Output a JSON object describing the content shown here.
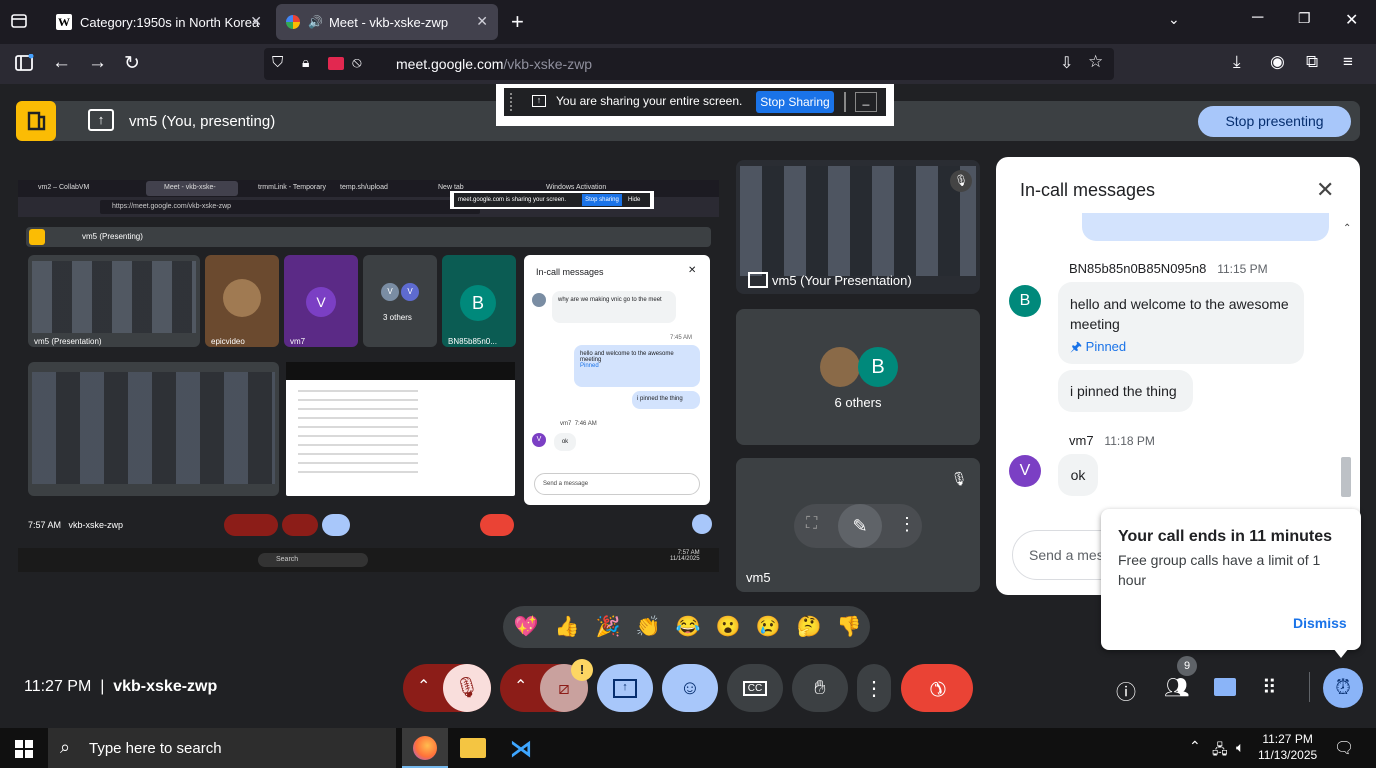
{
  "browser": {
    "tabs": [
      {
        "title": "Category:1950s in North Korea",
        "favicon": "W",
        "active": false
      },
      {
        "title": "Meet - vkb-xske-zwp",
        "active": true
      }
    ],
    "new_tab": "+",
    "url": {
      "domain": "meet.google.com",
      "path": "/vkb-xske-zwp"
    }
  },
  "share_notice": {
    "text": "You are sharing your entire screen.",
    "stop_button": "Stop Sharing",
    "hide_button": "_"
  },
  "presenting_bar": {
    "label": "vm5 (You, presenting)",
    "stop_button": "Stop presenting"
  },
  "tiles": {
    "presentation_label": "vm5 (Your Presentation)",
    "others_label": "6 others",
    "others_avatar": "B",
    "self_label": "vm5"
  },
  "mini_screen": {
    "tabs": [
      "vm2 – CollabVM",
      "Meet - vkb-xske-",
      "trmmLink - Temporary",
      "temp.sh/upload",
      "New tab",
      "Windows Activation"
    ],
    "url": "https://meet.google.com/vkb-xske-zwp",
    "share_notice": "meet.google.com is sharing your screen.",
    "stop_sharing": "Stop sharing",
    "hide": "Hide",
    "presenting": "vm5 (Presenting)",
    "tiles": [
      {
        "name": "vm5 (Presentation)"
      },
      {
        "name": "epicvideo"
      },
      {
        "name": "vm7",
        "avatar": "V"
      },
      {
        "name": "3 others",
        "avatar_a": "V",
        "avatar_b": "V"
      },
      {
        "name": "BN85b85n0...",
        "avatar": "B"
      }
    ],
    "chat_title": "In-call messages",
    "messages": [
      {
        "text": "why are we making vnic go to the meet"
      },
      {
        "time": "7:45 AM",
        "text": "hello and welcome to the awesome meeting",
        "pinned": "Pinned"
      },
      {
        "text": "i pinned the thing"
      },
      {
        "sender": "vm7",
        "time": "7:46 AM",
        "text": "ok",
        "avatar": "V"
      }
    ],
    "send_placeholder": "Send a message",
    "time": "7:57 AM",
    "meeting_code": "vkb-xske-zwp",
    "taskbar_search": "Search",
    "clock_time": "7:57 AM",
    "clock_date": "11/14/2025"
  },
  "chat": {
    "title": "In-call messages",
    "messages": [
      {
        "sender": "BN85b85n0B85N095n8",
        "time": "11:15 PM",
        "avatar": "B",
        "text": "hello and welcome to the awesome meeting",
        "pinned": "Pinned"
      },
      {
        "text": "i pinned the thing"
      },
      {
        "sender": "vm7",
        "time": "11:18 PM",
        "avatar": "V",
        "text": "ok"
      }
    ],
    "input_placeholder": "Send a mes"
  },
  "call_end_notice": {
    "title": "Your call ends in 11 minutes",
    "body": "Free group calls have a limit of 1 hour",
    "dismiss": "Dismiss"
  },
  "reactions": [
    "💖",
    "👍",
    "🎉",
    "👏",
    "😂",
    "😮",
    "😢",
    "🤔",
    "👎"
  ],
  "bottom_bar": {
    "time": "11:27 PM",
    "separator": "|",
    "meeting_code": "vkb-xske-zwp",
    "people_count": "9",
    "warning_badge": "!"
  },
  "taskbar": {
    "search_placeholder": "Type here to search",
    "time": "11:27 PM",
    "date": "11/13/2025"
  },
  "colors": {
    "meet_bg": "#202124",
    "accent_blue": "#8ab4f8",
    "hangup_red": "#ea4335",
    "mic_off_bg": "#f9dedc",
    "pinned_blue": "#1a73e8",
    "avatar_b": "#00897b",
    "avatar_v": "#7b3fc4"
  }
}
